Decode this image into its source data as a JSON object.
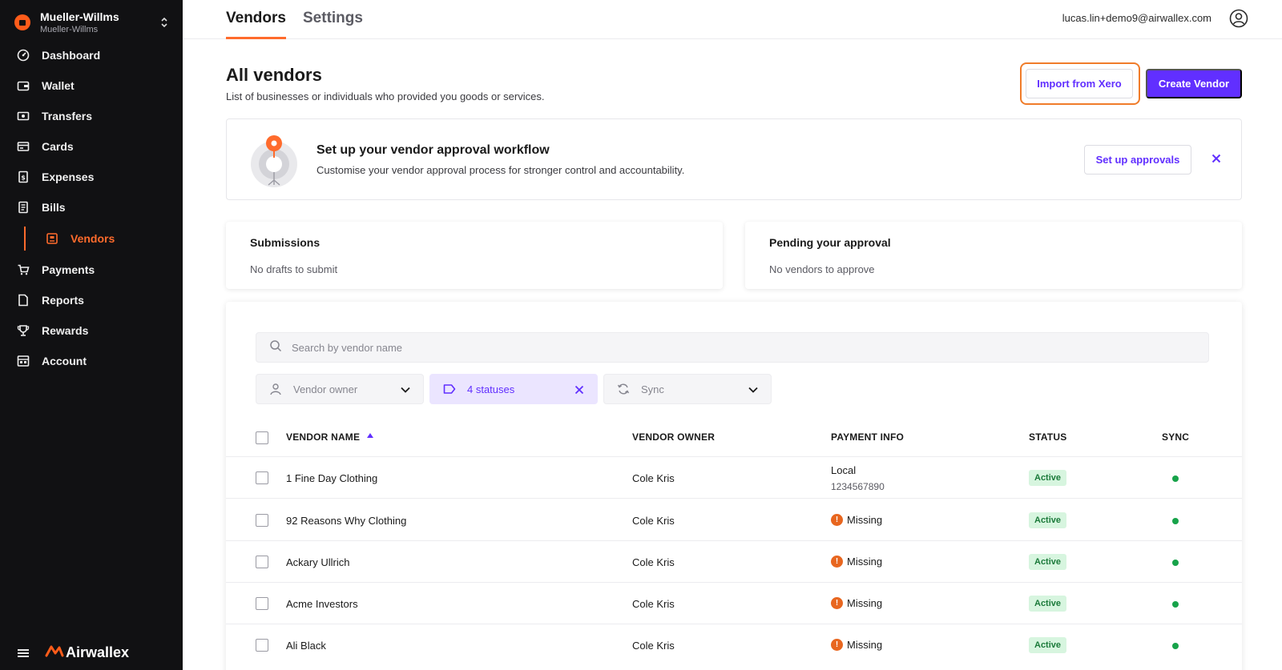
{
  "org": {
    "name": "Mueller-Willms",
    "sub": "Mueller-Willms",
    "toggle_glyph": "⌃⌄"
  },
  "nav": [
    {
      "label": "Dashboard",
      "icon": "dashboard-icon"
    },
    {
      "label": "Wallet",
      "icon": "wallet-icon"
    },
    {
      "label": "Transfers",
      "icon": "transfers-icon"
    },
    {
      "label": "Cards",
      "icon": "cards-icon"
    },
    {
      "label": "Expenses",
      "icon": "expenses-icon"
    },
    {
      "label": "Bills",
      "icon": "bills-icon"
    },
    {
      "label": "Vendors",
      "icon": "vendors-icon",
      "sub": true,
      "active": true
    },
    {
      "label": "Payments",
      "icon": "payments-icon"
    },
    {
      "label": "Reports",
      "icon": "reports-icon"
    },
    {
      "label": "Rewards",
      "icon": "rewards-icon"
    },
    {
      "label": "Account",
      "icon": "account-icon"
    }
  ],
  "brand": {
    "name": "Airwallex"
  },
  "tabs": {
    "vendors": "Vendors",
    "settings": "Settings"
  },
  "user": {
    "email": "lucas.lin+demo9@airwallex.com"
  },
  "page": {
    "title": "All vendors",
    "subtitle": "List of businesses or individuals who provided you goods or services.",
    "import_label": "Import from Xero",
    "create_label": "Create Vendor"
  },
  "banner": {
    "title": "Set up your vendor approval workflow",
    "description": "Customise your vendor approval process for stronger control and accountability.",
    "button_label": "Set up approvals",
    "close_glyph": "✕"
  },
  "submissions": {
    "title": "Submissions",
    "description": "No drafts to submit"
  },
  "pending": {
    "title": "Pending your approval",
    "description": "No vendors to approve"
  },
  "search": {
    "placeholder": "Search by vendor name",
    "value": ""
  },
  "filters": {
    "owner": "Vendor owner",
    "statuses": "4 statuses",
    "sync": "Sync"
  },
  "table": {
    "columns": {
      "name": "VENDOR NAME",
      "owner": "VENDOR OWNER",
      "payment": "PAYMENT INFO",
      "status": "STATUS",
      "sync": "SYNC"
    },
    "rows": [
      {
        "name": "1 Fine Day Clothing",
        "owner": "Cole Kris",
        "payment": "Local",
        "payment_detail": "1234567890",
        "missing": false,
        "status": "Active"
      },
      {
        "name": "92 Reasons Why Clothing",
        "owner": "Cole Kris",
        "payment": "Missing",
        "payment_detail": "",
        "missing": true,
        "status": "Active"
      },
      {
        "name": "Ackary Ullrich",
        "owner": "Cole Kris",
        "payment": "Missing",
        "payment_detail": "",
        "missing": true,
        "status": "Active"
      },
      {
        "name": "Acme Investors",
        "owner": "Cole Kris",
        "payment": "Missing",
        "payment_detail": "",
        "missing": true,
        "status": "Active"
      },
      {
        "name": "Ali Black",
        "owner": "Cole Kris",
        "payment": "Missing",
        "payment_detail": "",
        "missing": true,
        "status": "Active"
      }
    ]
  },
  "colors": {
    "accent": "#612fff",
    "brand": "#ff6b2c",
    "sidebar": "#111113",
    "active_badge": "#d7f5df",
    "sync_ok": "#17a34a",
    "missing": "#e8661f"
  }
}
